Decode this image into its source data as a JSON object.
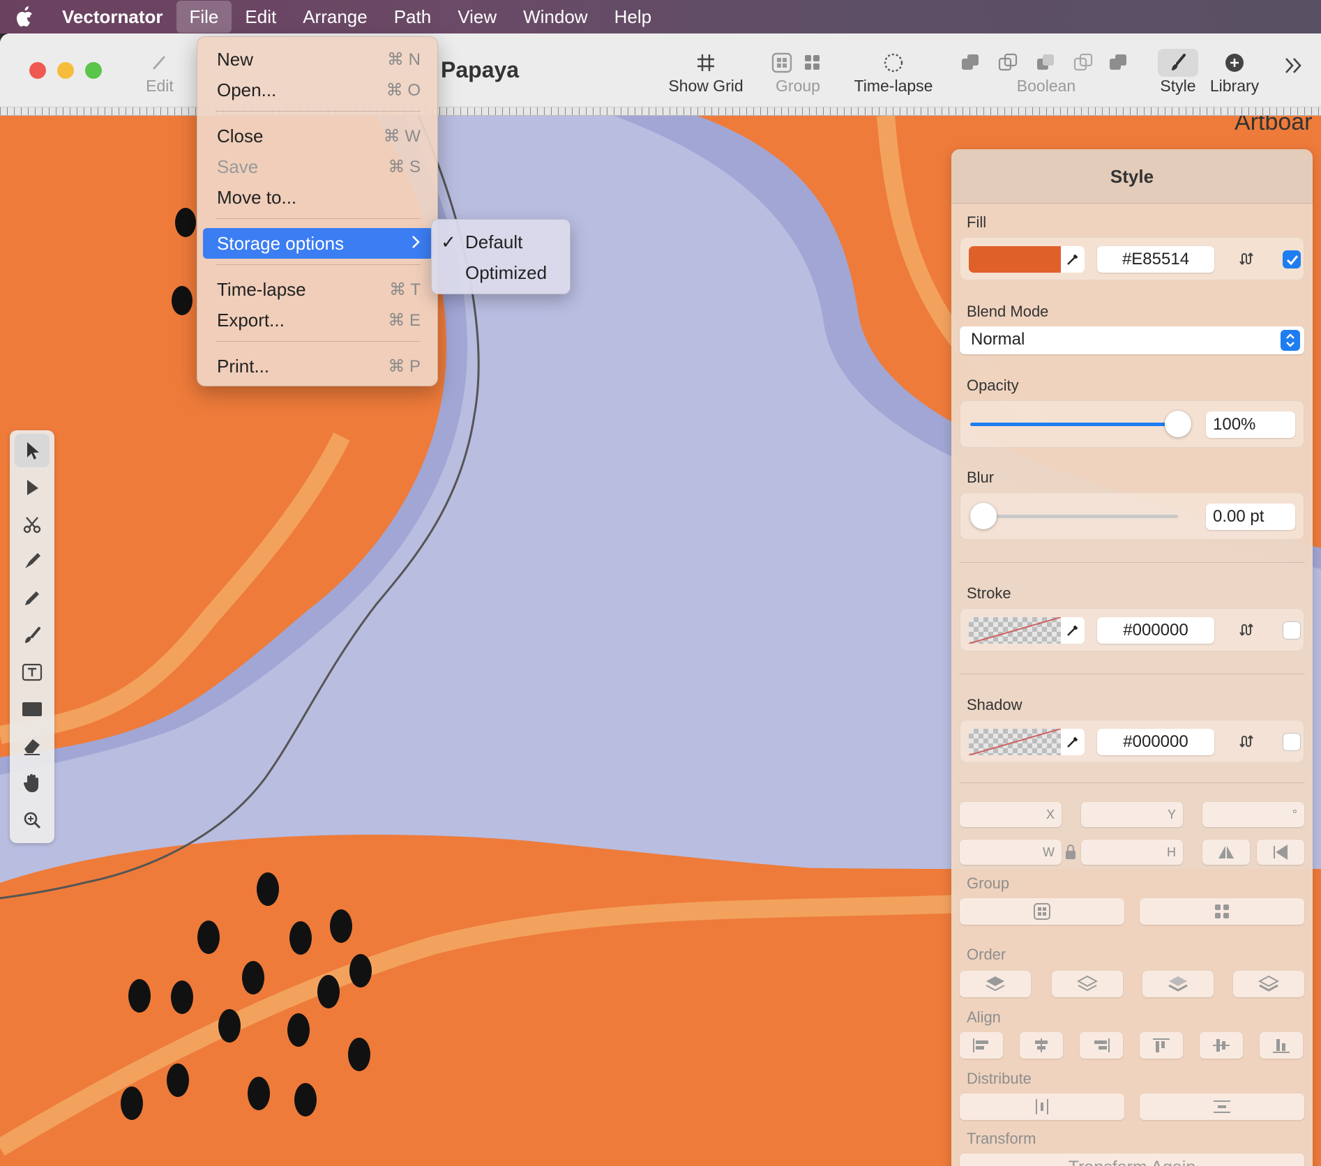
{
  "menubar": {
    "app_name": "Vectornator",
    "items": [
      "File",
      "Edit",
      "Arrange",
      "Path",
      "View",
      "Window",
      "Help"
    ],
    "active": "File"
  },
  "toolbar": {
    "edit_label": "Edit",
    "document_title": "Papaya",
    "show_grid": "Show Grid",
    "group": "Group",
    "time_lapse": "Time-lapse",
    "boolean": "Boolean",
    "style": "Style",
    "library": "Library"
  },
  "canvas": {
    "artboard_label": "Artboar",
    "colors": {
      "orange": "#ee7b3a",
      "light_orange": "#f3a25e",
      "lavender": "#b9bde0",
      "dark_lavender": "#a0a6d4",
      "seed": "#111111"
    }
  },
  "file_menu": {
    "items": [
      {
        "label": "New",
        "shortcut": "⌘ N"
      },
      {
        "label": "Open...",
        "shortcut": "⌘ O"
      },
      {
        "label": "Close",
        "shortcut": "⌘ W"
      },
      {
        "label": "Save",
        "shortcut": "⌘ S"
      },
      {
        "label": "Move to...",
        "shortcut": ""
      },
      {
        "label": "Storage options",
        "shortcut": ""
      },
      {
        "label": "Time-lapse",
        "shortcut": "⌘ T"
      },
      {
        "label": "Export...",
        "shortcut": "⌘ E"
      },
      {
        "label": "Print...",
        "shortcut": "⌘ P"
      }
    ],
    "submenu": {
      "items": [
        {
          "label": "Default",
          "checked": true
        },
        {
          "label": "Optimized",
          "checked": false
        }
      ]
    }
  },
  "style_panel": {
    "title": "Style",
    "fill": {
      "label": "Fill",
      "hex": "#E85514",
      "swatch": "#e0602a",
      "enabled": true
    },
    "blend": {
      "label": "Blend Mode",
      "value": "Normal"
    },
    "opacity": {
      "label": "Opacity",
      "value": "100%",
      "level": 1.0
    },
    "blur": {
      "label": "Blur",
      "value": "0.00 pt",
      "level": 0.0
    },
    "stroke": {
      "label": "Stroke",
      "hex": "#000000",
      "enabled": false
    },
    "shadow": {
      "label": "Shadow",
      "hex": "#000000",
      "enabled": false
    },
    "geometry": {
      "x": "X",
      "y": "Y",
      "rotation": "°",
      "w": "W",
      "h": "H"
    },
    "group_label": "Group",
    "order_label": "Order",
    "align_label": "Align",
    "distribute_label": "Distribute",
    "transform_label": "Transform",
    "transform_again": "Transform Again"
  }
}
